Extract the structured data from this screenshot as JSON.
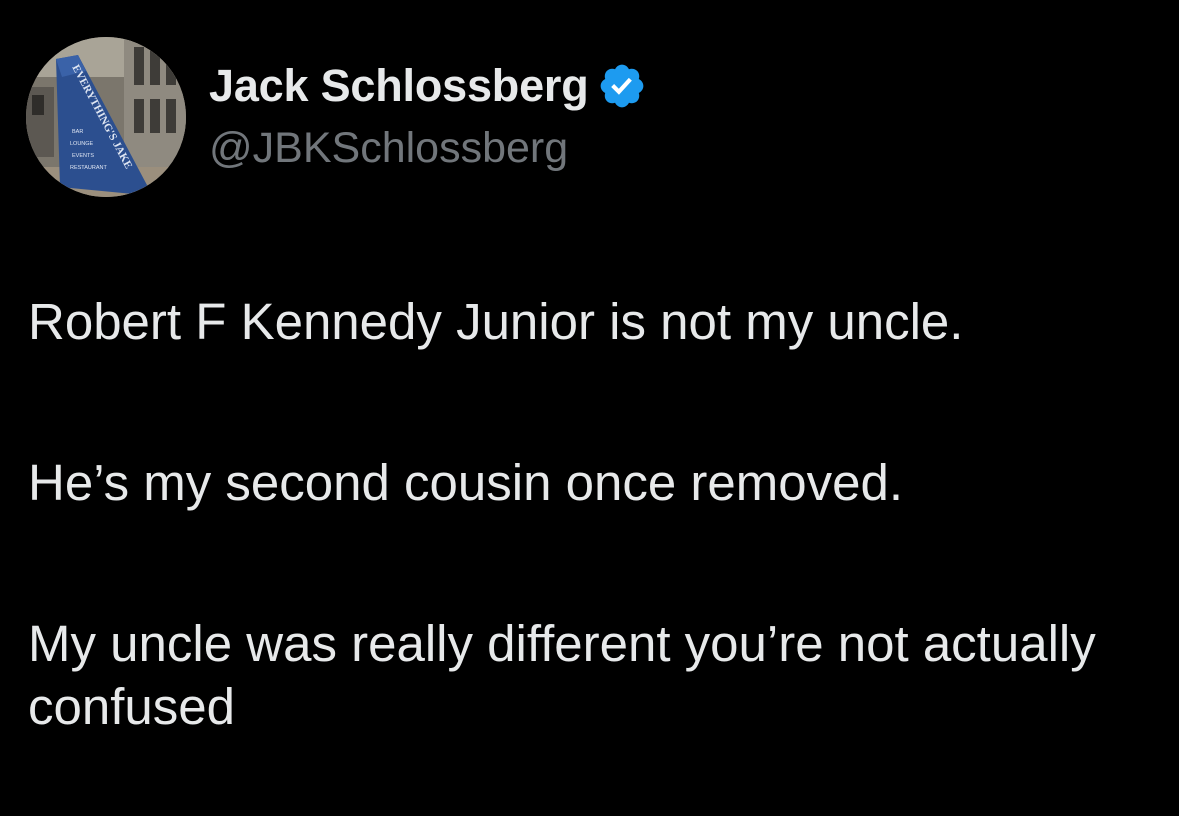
{
  "user": {
    "display_name": "Jack Schlossberg",
    "handle": "@JBKSchlossberg",
    "verified_icon": "verified-badge-icon",
    "avatar_sign_text": "EVERYTHING'S JAKE",
    "avatar_sign_lines": [
      "BAR",
      "LOUNGE",
      "EVENTS",
      "RESTAURANT"
    ]
  },
  "tweet": {
    "paragraphs": [
      "Robert F Kennedy Junior is not my uncle.",
      "He’s my second cousin once removed.",
      "My uncle was really different you’re not actually confused"
    ]
  },
  "colors": {
    "background": "#000000",
    "text_primary": "#e7e9ea",
    "text_secondary": "#71767b",
    "verified_blue": "#1d9bf0"
  }
}
